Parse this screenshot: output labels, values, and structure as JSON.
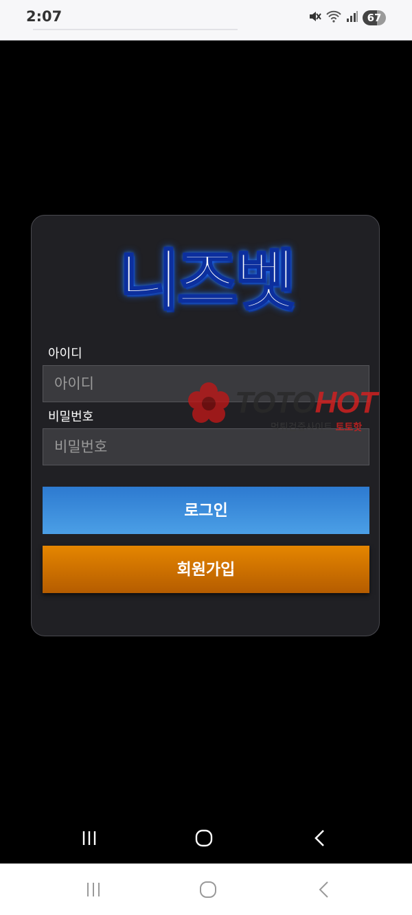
{
  "status": {
    "time": "2:07",
    "battery": "67",
    "icons": [
      "mute-icon",
      "wifi-icon",
      "signal-icon"
    ]
  },
  "login": {
    "logo": "니즈벳",
    "id_label": "아이디",
    "id_placeholder": "아이디",
    "pw_label": "비밀번호",
    "pw_placeholder": "비밀번호",
    "login_button": "로그인",
    "signup_button": "회원가입"
  },
  "watermark": {
    "brand_part1": "TOTO",
    "brand_part2": "HOT",
    "tagline": "먹튀검증사이트",
    "tagline_red": "토토핫"
  },
  "nav": {
    "buttons": [
      "recent-apps-icon",
      "home-icon",
      "back-icon"
    ]
  },
  "colors": {
    "login_button": "#3a8ddc",
    "signup_button": "#d67600",
    "card_bg": "#202024"
  }
}
